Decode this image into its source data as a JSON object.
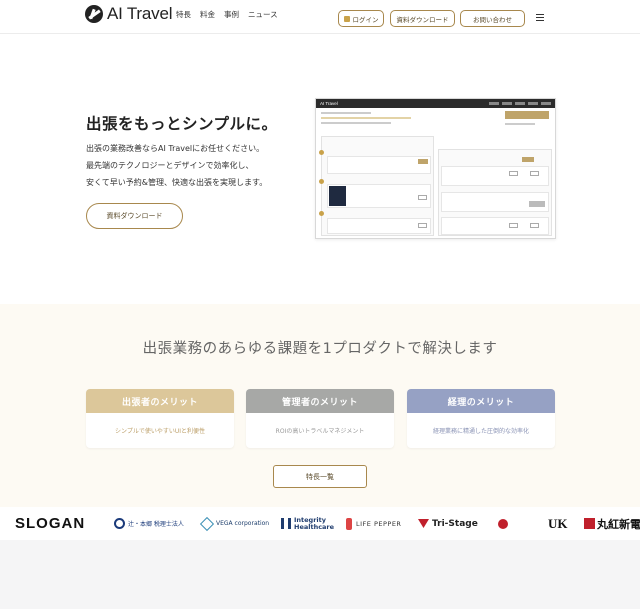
{
  "header": {
    "brand": "AI Travel",
    "nav": [
      "特長",
      "料金",
      "事例",
      "ニュース"
    ],
    "login_label": "ログイン",
    "doc_label": "資料ダウンロード",
    "contact_label": "お問い合わせ"
  },
  "hero": {
    "title": "出張をもっとシンプルに。",
    "desc_lines": [
      "出張の業務改善ならAI Travelにお任せください。",
      "最先端のテクノロジーとデザインで効率化し、",
      "安くて早い予約&管理、快適な出張を実現します。"
    ],
    "cta_label": "資料ダウンロード"
  },
  "mock": {
    "brand": "AI Travel"
  },
  "merits": {
    "title": "出張業務のあらゆる課題を1プロダクトで解決します",
    "cards": [
      {
        "head": "出張者のメリット",
        "body": "シンプルで使いやすいUIと利便性",
        "color": "#dcc79a"
      },
      {
        "head": "管理者のメリット",
        "body": "ROIの高いトラベルマネジメント",
        "color": "#a7a8a6"
      },
      {
        "head": "経理のメリット",
        "body": "経理業務に精通した圧倒的な効率化",
        "color": "#96a1c4"
      }
    ],
    "feature_btn": "特長一覧"
  },
  "logos": {
    "slogan": "SLOGAN",
    "tsuji": "辻・本郷 税理士法人",
    "vega": "VEGA corporation",
    "integrity_1": "Integrity",
    "integrity_2": "Healthcare",
    "pepper": "LIFE PEPPER",
    "tristage": "Tri-Stage",
    "uk": "UK",
    "marubeni": "丸紅新電"
  },
  "colors": {
    "accent_gold": "#a8884d",
    "section_bg": "#fdfaf3"
  }
}
